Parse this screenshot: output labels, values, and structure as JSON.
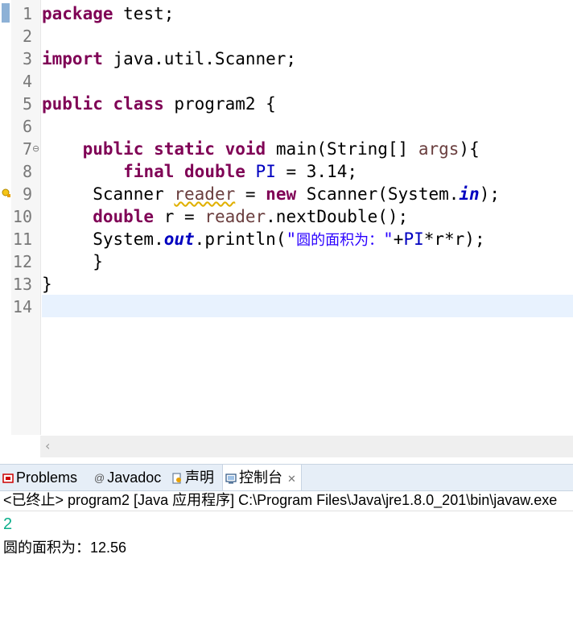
{
  "editor": {
    "line_numbers": [
      "1",
      "2",
      "3",
      "4",
      "5",
      "6",
      "7",
      "8",
      "9",
      "10",
      "11",
      "12",
      "13",
      "14"
    ],
    "line1": {
      "kw": "package",
      "rest": " test;"
    },
    "line3": {
      "kw": "import",
      "rest": " java.util.Scanner;"
    },
    "line5": {
      "kw1": "public",
      "kw2": "class",
      "rest": " program2 {"
    },
    "line7": {
      "indent": "    ",
      "kw1": "public",
      "kw2": "static",
      "kw3": "void",
      "rest1": " main(String[] ",
      "param": "args",
      "rest2": "){"
    },
    "line8": {
      "indent": "        ",
      "kw1": "final",
      "kw2": "double",
      "const": "PI",
      "rest": " = 3.14;"
    },
    "line9": {
      "indent": "     ",
      "type": "Scanner ",
      "var": "reader",
      "eq": " = ",
      "kw": "new",
      "rest1": " Scanner(System.",
      "field": "in",
      "rest2": ");"
    },
    "line10": {
      "indent": "     ",
      "kw": "double",
      "rest1": " r = ",
      "var": "reader",
      "rest2": ".nextDouble();"
    },
    "line11": {
      "indent": "     ",
      "pre": "System.",
      "field": "out",
      "call": ".println(",
      "str_open": "\"",
      "str_cn": "圆的面积为：",
      "str_close": "\"",
      "plus": "+",
      "const": "PI",
      "rest": "*r*r);"
    },
    "line12": {
      "indent": "     ",
      "text": "}"
    },
    "line13": {
      "text": "}"
    }
  },
  "tabs": {
    "problems": "Problems",
    "javadoc": "Javadoc",
    "declaration": "声明",
    "console": "控制台"
  },
  "console": {
    "header": "<已终止> program2 [Java 应用程序] C:\\Program Files\\Java\\jre1.8.0_201\\bin\\javaw.exe",
    "input": "2",
    "output": "圆的面积为：12.56"
  },
  "colors": {
    "keyword": "#7f0055",
    "field": "#0000c0",
    "string": "#2a00ff",
    "current_line": "#e8f2fe",
    "console_input": "#0bae8a"
  }
}
